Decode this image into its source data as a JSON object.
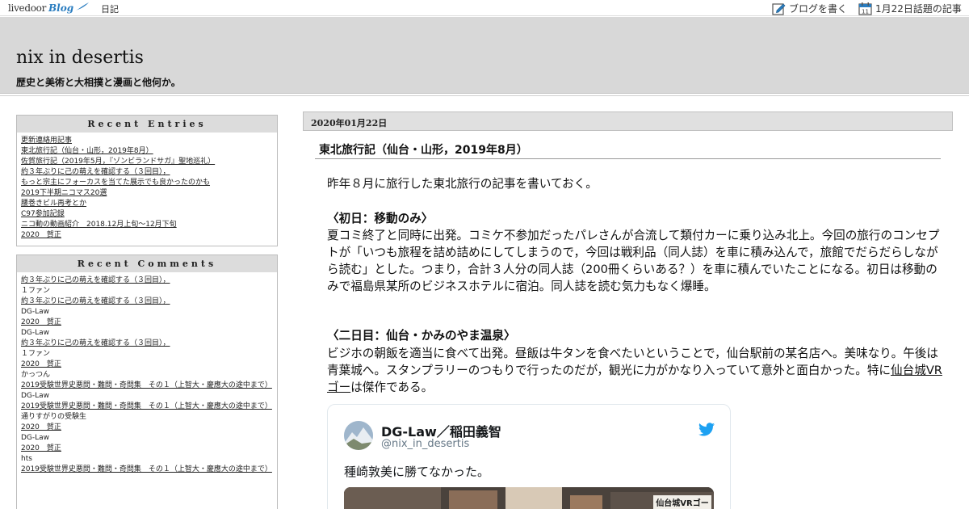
{
  "topbar": {
    "logo_text": "livedoor",
    "logo_blog": "Blog",
    "diary_link": "日記",
    "write_blog": "ブログを書く",
    "calendar_day": "11",
    "trending": "1月22日話題の記事"
  },
  "header": {
    "title": "nix in desertis",
    "description": "歴史と美術と大相撲と漫画と他何か。"
  },
  "sidebar": {
    "recent_entries": {
      "title": "Recent Entries",
      "items": [
        "更新連絡用記事",
        "東北旅行記（仙台・山形，2019年8月）",
        "佐賀旅行記（2019年5月，『ゾンビランドサガ』聖地巡礼）",
        "約３年ぶりに己の萌えを確認する（３回目），",
        "もっと宗主にフォーカスを当てた展示でも良かったのかも",
        "2019下半期ニコマス20選",
        "腰巻きビル再考とか",
        "C97参加記録",
        "ニコ動の動画紹介　2018.12月上旬～12月下旬",
        "2020　賀正"
      ]
    },
    "recent_comments": {
      "title": "Recent Comments",
      "items": [
        {
          "text": "約３年ぶりに己の萌えを確認する（３回目），",
          "link": true
        },
        {
          "text": "１ファン",
          "link": false
        },
        {
          "text": "約３年ぶりに己の萌えを確認する（３回目），",
          "link": true
        },
        {
          "text": "DG-Law",
          "link": false
        },
        {
          "text": "2020　賀正",
          "link": true
        },
        {
          "text": "DG-Law",
          "link": false
        },
        {
          "text": "約３年ぶりに己の萌えを確認する（３回目），",
          "link": true
        },
        {
          "text": "１ファン",
          "link": false
        },
        {
          "text": "2020　賀正",
          "link": true
        },
        {
          "text": "かっつん",
          "link": false
        },
        {
          "text": "2019受験世界史悪問・難問・奇問集　その１（上智大・慶應大の途中まで）",
          "link": true
        },
        {
          "text": "DG-Law",
          "link": false
        },
        {
          "text": "2019受験世界史悪問・難問・奇問集　その１（上智大・慶應大の途中まで）",
          "link": true
        },
        {
          "text": "通りすがりの受験生",
          "link": false
        },
        {
          "text": "2020　賀正",
          "link": true
        },
        {
          "text": "DG-Law",
          "link": false
        },
        {
          "text": "2020　賀正",
          "link": true
        },
        {
          "text": "hts",
          "link": false
        },
        {
          "text": "2019受験世界史悪問・難問・奇問集　その１（上智大・慶應大の途中まで）",
          "link": true
        }
      ]
    }
  },
  "entry": {
    "date": "2020年01月22日",
    "title": "東北旅行記（仙台・山形，2019年8月）",
    "intro": "昨年８月に旅行した東北旅行の記事を書いておく。",
    "day1_heading": "〈初日：移動のみ〉",
    "day1_body": "夏コミ終了と同時に出発。コミケ不参加だったパレさんが合流して類付カーに乗り込み北上。今回の旅行のコンセプトが「いつも旅程を詰め詰めにしてしまうので，今回は戦利品（同人誌）を車に積み込んで，旅館でだらだらしながら読む」とした。つまり，合計３人分の同人誌（200冊くらいある？）を車に積んでいたことになる。初日は移動のみで福島県某所のビジネスホテルに宿泊。同人誌を読む気力もなく爆睡。",
    "day2_heading": "〈二日目：仙台・かみのやま温泉〉",
    "day2_body_before": "ビジホの朝飯を適当に食べて出発。昼飯は牛タンを食べたいということで，仙台駅前の某名店へ。美味なり。午後は青葉城へ。スタンプラリーのつもりで行ったのだが，観光に力がかなり入っていて意外と面白かった。特に",
    "day2_link": "仙台城VRゴー",
    "day2_body_after": "は傑作である。"
  },
  "tweet": {
    "name": "DG-Law／稲田義智",
    "handle": "@nix_in_desertis",
    "text": "種崎敦美に勝てなかった。",
    "media_sign": "仙台城VRゴー"
  },
  "colors": {
    "header_bg": "#d8d8d8",
    "sidebar_title_bg": "#dcdcdc",
    "twitter_blue": "#1da1f2"
  }
}
